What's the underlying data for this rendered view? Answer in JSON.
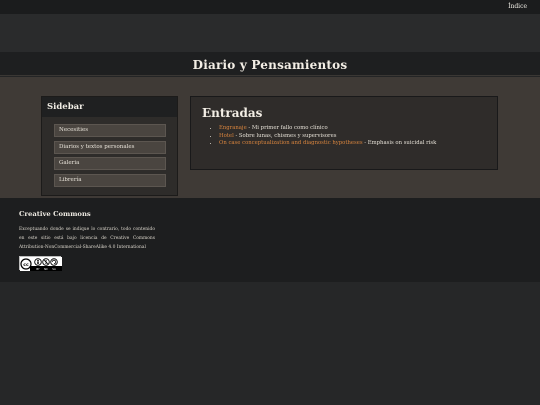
{
  "topnav": {
    "index_link": "Índice"
  },
  "site": {
    "title": "Diario y Pensamientos"
  },
  "sidebar": {
    "heading": "Sidebar",
    "items": [
      {
        "label": "Necesities"
      },
      {
        "label": "Diarios y textos personales"
      },
      {
        "label": "Galeria"
      },
      {
        "label": "Librería"
      }
    ]
  },
  "entries": {
    "heading": "Entradas",
    "items": [
      {
        "link": "Engranaje",
        "desc": " - Mi primer fallo como clínico"
      },
      {
        "link": "Hotel",
        "desc": " - Sobre lunas, chismes y supervisores"
      },
      {
        "link": "On case conceptualization and diagnostic hypotheses",
        "desc": " - Emphasis on suicidal risk"
      }
    ]
  },
  "footer": {
    "heading": "Creative Commons",
    "text": "Exceptuando donde se indique lo contrario, todo contenido en este sitio está bajo licencia de Creative Commons Attribution-NonCommercial-ShareAlike 4.0 International",
    "badge": {
      "parts": [
        "cc",
        "by",
        "nc",
        "sa"
      ],
      "labels": [
        "BY",
        "NC",
        "SA"
      ]
    }
  },
  "colors": {
    "accent_link": "#d9853e",
    "band": "#3f3a36",
    "header": "#1e1f20"
  }
}
